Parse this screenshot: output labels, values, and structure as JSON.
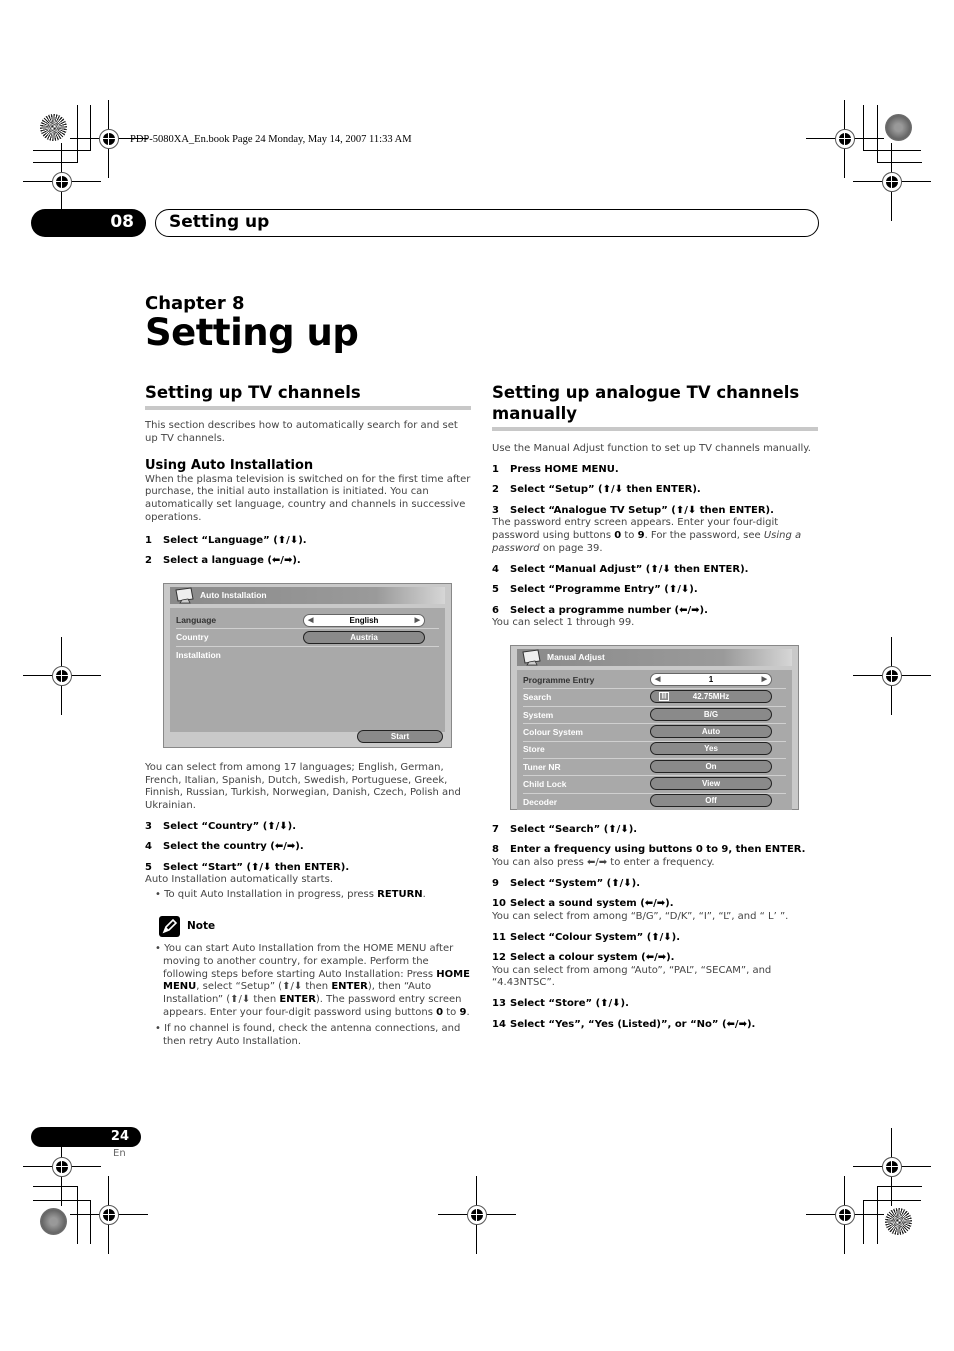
{
  "print_header": "PDP-5080XA_En.book  Page 24  Monday, May 14, 2007  11:33 AM",
  "chapter_tab": {
    "number": "08",
    "title": "Setting up"
  },
  "chapter": {
    "label": "Chapter 8",
    "title": "Setting up"
  },
  "left_column": {
    "heading": "Setting up TV channels",
    "intro": "This section describes how to automatically search for and set up TV channels.",
    "subheading": "Using Auto Installation",
    "sub_intro": "When the plasma television is switched on for the first time after purchase, the initial auto installation is initiated. You can automatically set language, country and channels in successive operations.",
    "steps_a": [
      {
        "n": "1",
        "text": "Select “Language” (⬆/⬇)."
      },
      {
        "n": "2",
        "text": "Select a language (⬅/➡)."
      }
    ],
    "osd": {
      "title": "Auto Installation",
      "rows": [
        {
          "label": "Language",
          "value": "English",
          "selected": true
        },
        {
          "label": "Country",
          "value": "Austria",
          "selected": false
        },
        {
          "label": "Installation",
          "value": "",
          "selected": false
        }
      ],
      "start_button": "Start"
    },
    "languages_note": "You can select from among 17 languages; English, German, French, Italian, Spanish, Dutch, Swedish, Portuguese, Greek, Finnish, Russian, Turkish, Norwegian, Danish, Czech, Polish and Ukrainian.",
    "steps_b": [
      {
        "n": "3",
        "text": "Select “Country” (⬆/⬇)."
      },
      {
        "n": "4",
        "text": "Select the country (⬅/➡)."
      },
      {
        "n": "5",
        "text": "Select “Start” (⬆/⬇ then ENTER)."
      }
    ],
    "step5_desc": "Auto Installation automatically starts.",
    "step5_bullet_pre": "To quit Auto Installation in progress, press ",
    "step5_bullet_key": "RETURN",
    "step5_bullet_post": ".",
    "note": {
      "label": "Note",
      "bullet1": {
        "t1": "You can start Auto Installation from the HOME MENU after moving to another country, for example. Perform the following steps before starting Auto Installation: Press ",
        "k1": "HOME MENU",
        "t2": ", select “Setup” (⬆/⬇ then ",
        "k2": "ENTER",
        "t3": "), then “Auto Installation” (⬆/⬇ then ",
        "k3": "ENTER",
        "t4": "). The password entry screen appears. Enter your four-digit password using buttons ",
        "k4": "0",
        "t5": " to ",
        "k5": "9",
        "t6": "."
      },
      "bullet2": "If no channel is found, check the antenna connections, and then retry Auto Installation."
    }
  },
  "right_column": {
    "heading": "Setting up analogue TV channels manually",
    "intro": "Use the Manual Adjust function to set up TV channels manually.",
    "steps_a": [
      {
        "n": "1",
        "text": "Press HOME MENU."
      },
      {
        "n": "2",
        "text": "Select “Setup” (⬆/⬇ then ENTER)."
      },
      {
        "n": "3",
        "text": "Select “Analogue TV Setup” (⬆/⬇ then ENTER)."
      }
    ],
    "step3_desc": {
      "t1": "The password entry screen appears. Enter your four-digit password using buttons ",
      "k1": "0",
      "t2": " to ",
      "k2": "9",
      "t3": ". For the password, see ",
      "link": "Using a password",
      "t4": " on page 39."
    },
    "steps_b": [
      {
        "n": "4",
        "text": "Select “Manual Adjust” (⬆/⬇ then ENTER)."
      },
      {
        "n": "5",
        "text": "Select “Programme Entry” (⬆/⬇)."
      },
      {
        "n": "6",
        "text": "Select a programme number (⬅/➡)."
      }
    ],
    "step6_desc": "You can select 1 through 99.",
    "osd": {
      "title": "Manual Adjust",
      "rows": [
        {
          "label": "Programme Entry",
          "value": "1",
          "selected": true
        },
        {
          "label": "Search",
          "value": "42.75MHz",
          "selected": false
        },
        {
          "label": "System",
          "value": "B/G",
          "selected": false
        },
        {
          "label": "Colour System",
          "value": "Auto",
          "selected": false
        },
        {
          "label": "Store",
          "value": "Yes",
          "selected": false
        },
        {
          "label": "Tuner NR",
          "value": "On",
          "selected": false
        },
        {
          "label": "Child Lock",
          "value": "View",
          "selected": false
        },
        {
          "label": "Decoder",
          "value": "Off",
          "selected": false
        }
      ]
    },
    "steps_c": [
      {
        "n": "7",
        "text": "Select “Search” (⬆/⬇).",
        "desc": ""
      },
      {
        "n": "8",
        "text": "Enter a frequency using buttons 0 to 9, then ENTER.",
        "desc": "You can also press ⬅/➡ to enter a frequency."
      },
      {
        "n": "9",
        "text": "Select “System” (⬆/⬇).",
        "desc": ""
      },
      {
        "n": "10",
        "text": "Select a sound system (⬅/➡).",
        "desc": "You can select from among “B/G”, “D/K”, “I”, “L”, and “ L’ ”."
      },
      {
        "n": "11",
        "text": "Select “Colour System” (⬆/⬇).",
        "desc": ""
      },
      {
        "n": "12",
        "text": "Select a colour system (⬅/➡).",
        "desc": "You can select from among “Auto”, “PAL”, “SECAM”, and “4.43NTSC”."
      },
      {
        "n": "13",
        "text": "Select “Store” (⬆/⬇).",
        "desc": ""
      },
      {
        "n": "14",
        "text": "Select “Yes”, “Yes (Listed)”, or “No” (⬅/➡).",
        "desc": ""
      }
    ]
  },
  "footer": {
    "page_number": "24",
    "language": "En"
  }
}
